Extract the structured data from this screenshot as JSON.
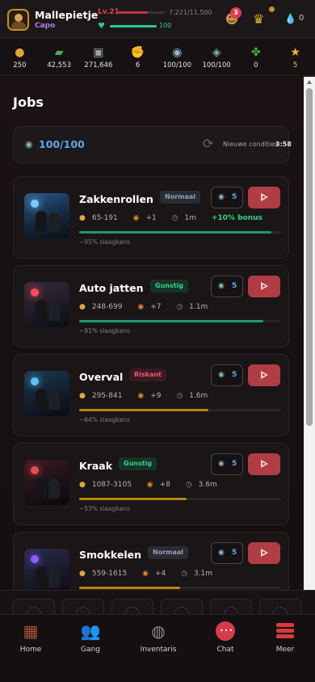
{
  "header": {
    "username": "Mallepietje",
    "rank": "Capo",
    "level": "Lv.21",
    "xp_text": "7,221/11,500",
    "xp_fraction": 0.63,
    "hp_text": "100",
    "hp_fraction": 1.0,
    "notification_count": "3",
    "premium_value": "0"
  },
  "resources": [
    {
      "icon": "gold-coins-icon",
      "value": "250"
    },
    {
      "icon": "cash-stack-icon",
      "value": "42,553"
    },
    {
      "icon": "safe-icon",
      "value": "271,646"
    },
    {
      "icon": "fist-icon",
      "value": "6"
    },
    {
      "icon": "energy-icon",
      "value": "100/100"
    },
    {
      "icon": "nerve-icon",
      "value": "100/100"
    },
    {
      "icon": "weed-icon",
      "value": "0"
    },
    {
      "icon": "star-icon",
      "value": "5"
    }
  ],
  "page": {
    "title": "Jobs",
    "energy_value": "100/100",
    "conditions_label": "Nieuwe condities",
    "conditions_time": "3:58"
  },
  "jobs": [
    {
      "name": "Zakkenrollen",
      "tag": "Normaal",
      "tag_type": "normal",
      "cost": "5",
      "money": "65-191",
      "xp": "+1",
      "time": "1m",
      "bonus": "+10% bonus",
      "chance": "~95% slaagkans",
      "chance_fraction": 0.95,
      "bar_color": "#1f9a68"
    },
    {
      "name": "Auto jatten",
      "tag": "Gunstig",
      "tag_type": "gunstig",
      "cost": "5",
      "money": "248-699",
      "xp": "+7",
      "time": "1.1m",
      "bonus": "",
      "chance": "~91% slaagkans",
      "chance_fraction": 0.91,
      "bar_color": "#1f9a68"
    },
    {
      "name": "Overval",
      "tag": "Riskant",
      "tag_type": "riskant",
      "cost": "5",
      "money": "295-841",
      "xp": "+9",
      "time": "1.6m",
      "bonus": "",
      "chance": "~64% slaagkans",
      "chance_fraction": 0.64,
      "bar_color": "#b8860b"
    },
    {
      "name": "Kraak",
      "tag": "Gunstig",
      "tag_type": "gunstig",
      "cost": "5",
      "money": "1087-3105",
      "xp": "+8",
      "time": "3.6m",
      "bonus": "",
      "chance": "~53% slaagkans",
      "chance_fraction": 0.53,
      "bar_color": "#b8860b"
    },
    {
      "name": "Smokkelen",
      "tag": "Normaal",
      "tag_type": "normal",
      "cost": "5",
      "money": "559-1615",
      "xp": "+4",
      "time": "3.1m",
      "bonus": "",
      "chance": "",
      "chance_fraction": 0.5,
      "bar_color": "#b8860b"
    }
  ],
  "nav": [
    {
      "label": "Home",
      "icon": "home-icon"
    },
    {
      "label": "Gang",
      "icon": "gang-icon"
    },
    {
      "label": "Inventaris",
      "icon": "inventory-icon"
    },
    {
      "label": "Chat",
      "icon": "chat-icon"
    },
    {
      "label": "Meer",
      "icon": "menu-icon"
    }
  ]
}
